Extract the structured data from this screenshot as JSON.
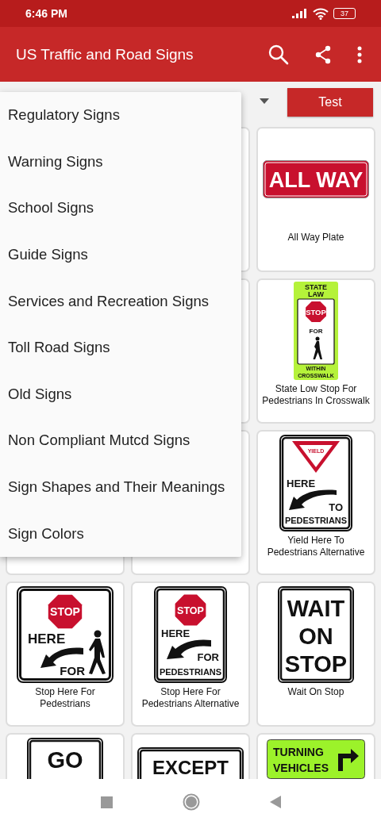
{
  "status_bar": {
    "time": "6:46 PM",
    "battery": "37"
  },
  "app_bar": {
    "title": "US Traffic and Road Signs"
  },
  "toolbar": {
    "test_button": "Test"
  },
  "menu": {
    "items": [
      {
        "label": "Regulatory Signs"
      },
      {
        "label": "Warning Signs"
      },
      {
        "label": "School Signs"
      },
      {
        "label": "Guide Signs"
      },
      {
        "label": "Services and Recreation Signs"
      },
      {
        "label": "Toll Road Signs"
      },
      {
        "label": "Old Signs"
      },
      {
        "label": "Non Compliant Mutcd Signs"
      },
      {
        "label": "Sign Shapes and Their Meanings"
      },
      {
        "label": "Sign Colors"
      }
    ]
  },
  "cards": [
    {
      "kind": "hidden"
    },
    {
      "kind": "covered"
    },
    {
      "kind": "sign",
      "sign": {
        "kind": "plate",
        "lines": [
          "ALL WAY"
        ]
      },
      "caption": "All Way Plate"
    },
    {
      "kind": "hidden"
    },
    {
      "kind": "covered"
    },
    {
      "kind": "sign",
      "sign": {
        "kind": "state_law",
        "lines": [
          "STATE",
          "LAW",
          "STOP",
          "FOR",
          "WITHIN",
          "CROSSWALK"
        ]
      },
      "caption": "State Low Stop For Pedestrians In Crosswalk"
    },
    {
      "kind": "covered"
    },
    {
      "kind": "covered"
    },
    {
      "kind": "sign",
      "sign": {
        "kind": "yield_here",
        "lines": [
          "YIELD",
          "HERE",
          "TO",
          "PEDESTRIANS"
        ]
      },
      "caption": "Yield Here To Pedestrians Alternative"
    },
    {
      "kind": "sign",
      "sign": {
        "kind": "stop_ped",
        "lines": [
          "STOP",
          "HERE",
          "FOR"
        ]
      },
      "caption": "Stop Here For Pedestrians"
    },
    {
      "kind": "sign",
      "sign": {
        "kind": "stop_ped_alt",
        "lines": [
          "STOP",
          "HERE",
          "FOR",
          "PEDESTRIANS"
        ]
      },
      "caption": "Stop Here For Pedestrians Alternative"
    },
    {
      "kind": "sign",
      "sign": {
        "kind": "text",
        "lines": [
          "WAIT",
          "ON",
          "STOP"
        ]
      },
      "caption": "Wait On Stop"
    },
    {
      "kind": "sign",
      "sign": {
        "kind": "text",
        "lines": [
          "GO"
        ]
      }
    },
    {
      "kind": "sign",
      "sign": {
        "kind": "text_wide",
        "lines": [
          "EXCEPT"
        ]
      }
    },
    {
      "kind": "sign",
      "sign": {
        "kind": "green_turn",
        "lines": [
          "TURNING",
          "VEHICLES"
        ]
      }
    }
  ]
}
